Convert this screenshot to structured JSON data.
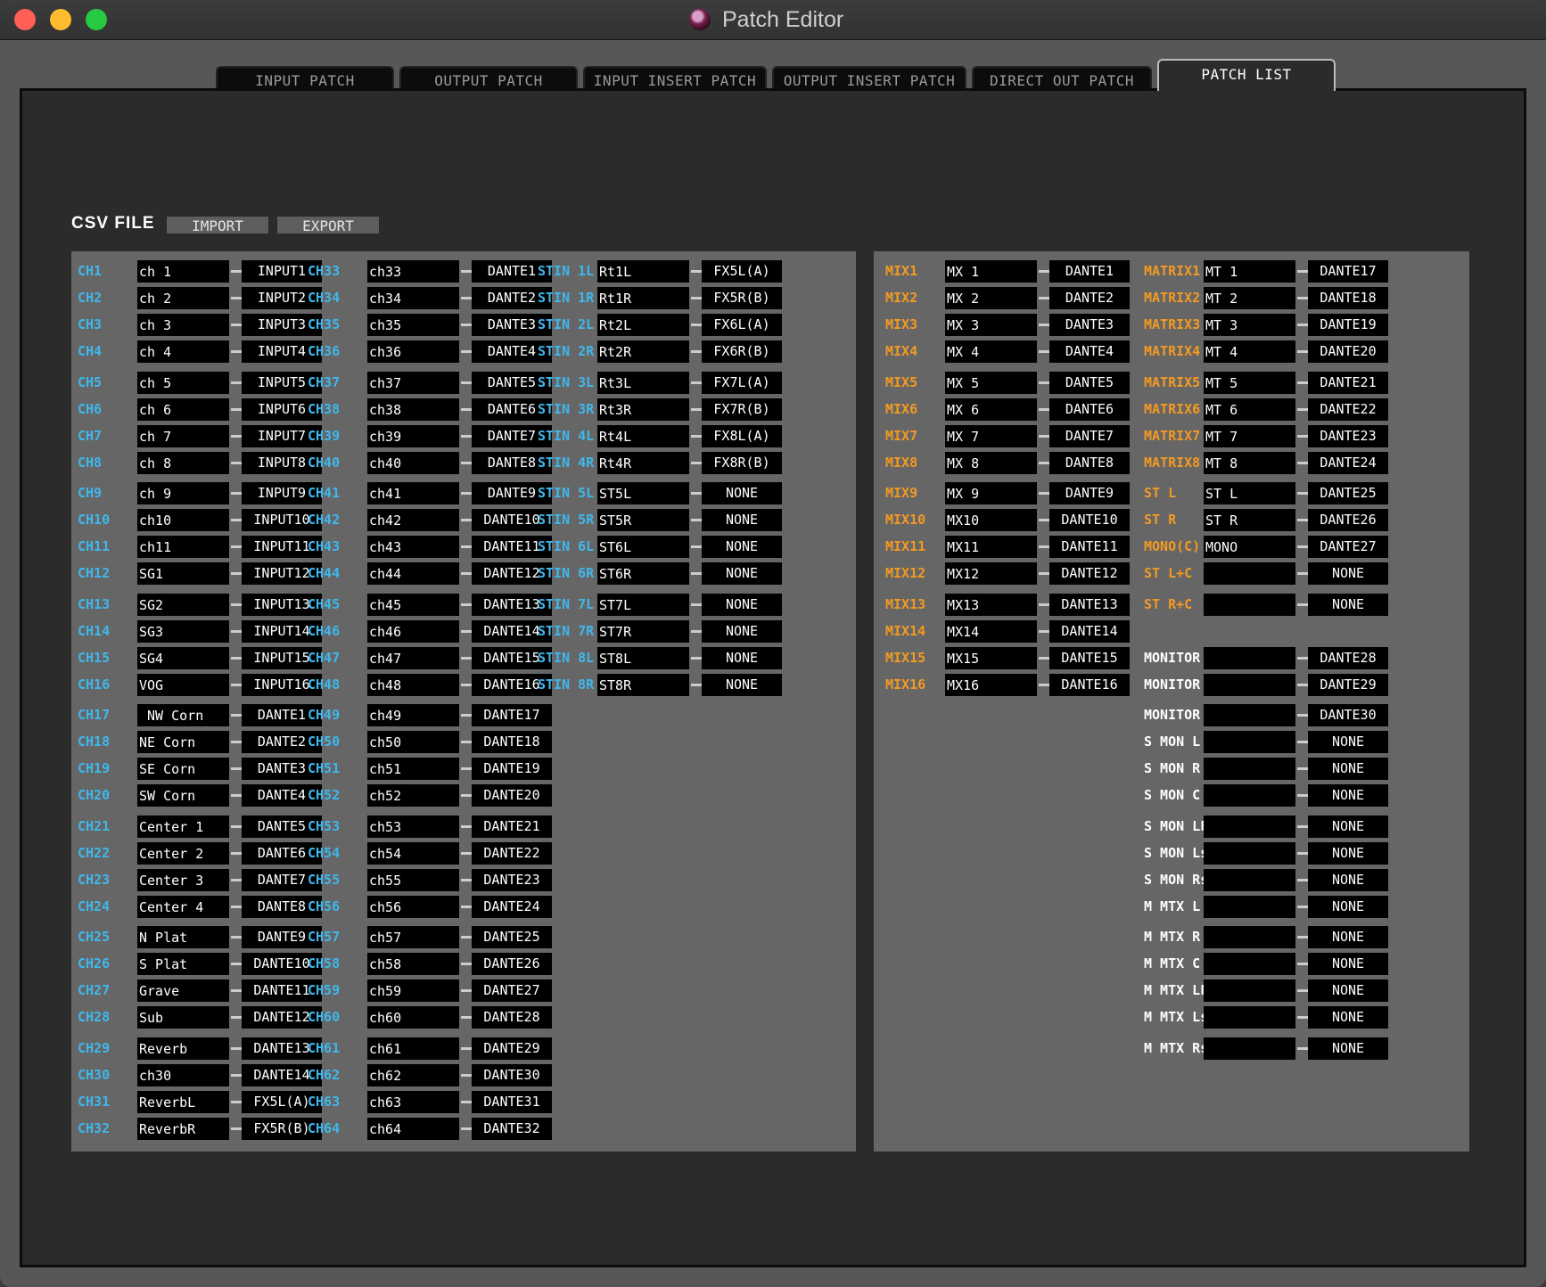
{
  "window": {
    "title": "Patch Editor"
  },
  "tabs": [
    {
      "label": "INPUT PATCH"
    },
    {
      "label": "OUTPUT PATCH"
    },
    {
      "label": "INPUT INSERT PATCH"
    },
    {
      "label": "OUTPUT INSERT PATCH"
    },
    {
      "label": "DIRECT OUT PATCH"
    },
    {
      "label": "PATCH LIST",
      "active": true
    }
  ],
  "csv": {
    "label": "CSV FILE",
    "import": "IMPORT",
    "export": "EXPORT"
  },
  "colors": {
    "input_label": "#3eb8ec",
    "output_label": "#f39a21",
    "monitor_label": "#ffffff",
    "cell_bg": "#000000",
    "panel_bg": "#666666"
  },
  "input_list": {
    "columns": [
      {
        "color": "cyan",
        "rows": [
          {
            "label": "CH1",
            "name": "ch 1",
            "patch": "INPUT1"
          },
          {
            "label": "CH2",
            "name": "ch 2",
            "patch": "INPUT2"
          },
          {
            "label": "CH3",
            "name": "ch 3",
            "patch": "INPUT3"
          },
          {
            "label": "CH4",
            "name": "ch 4",
            "patch": "INPUT4"
          },
          {
            "label": "CH5",
            "name": "ch 5",
            "patch": "INPUT5"
          },
          {
            "label": "CH6",
            "name": "ch 6",
            "patch": "INPUT6"
          },
          {
            "label": "CH7",
            "name": "ch 7",
            "patch": "INPUT7"
          },
          {
            "label": "CH8",
            "name": "ch 8",
            "patch": "INPUT8"
          },
          {
            "label": "CH9",
            "name": "ch 9",
            "patch": "INPUT9"
          },
          {
            "label": "CH10",
            "name": "ch10",
            "patch": "INPUT10"
          },
          {
            "label": "CH11",
            "name": "ch11",
            "patch": "INPUT11"
          },
          {
            "label": "CH12",
            "name": "SG1",
            "patch": "INPUT12"
          },
          {
            "label": "CH13",
            "name": "SG2",
            "patch": "INPUT13"
          },
          {
            "label": "CH14",
            "name": "SG3",
            "patch": "INPUT14"
          },
          {
            "label": "CH15",
            "name": "SG4",
            "patch": "INPUT15"
          },
          {
            "label": "CH16",
            "name": "VOG",
            "patch": "INPUT16"
          },
          {
            "label": "CH17",
            "name": " NW Corn",
            "patch": "DANTE1"
          },
          {
            "label": "CH18",
            "name": "NE Corn",
            "patch": "DANTE2"
          },
          {
            "label": "CH19",
            "name": "SE Corn",
            "patch": "DANTE3"
          },
          {
            "label": "CH20",
            "name": "SW Corn",
            "patch": "DANTE4"
          },
          {
            "label": "CH21",
            "name": "Center 1",
            "patch": "DANTE5"
          },
          {
            "label": "CH22",
            "name": "Center 2",
            "patch": "DANTE6"
          },
          {
            "label": "CH23",
            "name": "Center 3",
            "patch": "DANTE7"
          },
          {
            "label": "CH24",
            "name": "Center 4",
            "patch": "DANTE8"
          },
          {
            "label": "CH25",
            "name": "N Plat",
            "patch": "DANTE9"
          },
          {
            "label": "CH26",
            "name": "S Plat",
            "patch": "DANTE10"
          },
          {
            "label": "CH27",
            "name": "Grave",
            "patch": "DANTE11"
          },
          {
            "label": "CH28",
            "name": "Sub",
            "patch": "DANTE12"
          },
          {
            "label": "CH29",
            "name": "Reverb",
            "patch": "DANTE13"
          },
          {
            "label": "CH30",
            "name": "ch30",
            "patch": "DANTE14"
          },
          {
            "label": "CH31",
            "name": "ReverbL",
            "patch": "FX5L(A)"
          },
          {
            "label": "CH32",
            "name": "ReverbR",
            "patch": "FX5R(B)"
          }
        ]
      },
      {
        "color": "cyan",
        "rows": [
          {
            "label": "CH33",
            "name": "ch33",
            "patch": "DANTE1"
          },
          {
            "label": "CH34",
            "name": "ch34",
            "patch": "DANTE2"
          },
          {
            "label": "CH35",
            "name": "ch35",
            "patch": "DANTE3"
          },
          {
            "label": "CH36",
            "name": "ch36",
            "patch": "DANTE4"
          },
          {
            "label": "CH37",
            "name": "ch37",
            "patch": "DANTE5"
          },
          {
            "label": "CH38",
            "name": "ch38",
            "patch": "DANTE6"
          },
          {
            "label": "CH39",
            "name": "ch39",
            "patch": "DANTE7"
          },
          {
            "label": "CH40",
            "name": "ch40",
            "patch": "DANTE8"
          },
          {
            "label": "CH41",
            "name": "ch41",
            "patch": "DANTE9"
          },
          {
            "label": "CH42",
            "name": "ch42",
            "patch": "DANTE10"
          },
          {
            "label": "CH43",
            "name": "ch43",
            "patch": "DANTE11"
          },
          {
            "label": "CH44",
            "name": "ch44",
            "patch": "DANTE12"
          },
          {
            "label": "CH45",
            "name": "ch45",
            "patch": "DANTE13"
          },
          {
            "label": "CH46",
            "name": "ch46",
            "patch": "DANTE14"
          },
          {
            "label": "CH47",
            "name": "ch47",
            "patch": "DANTE15"
          },
          {
            "label": "CH48",
            "name": "ch48",
            "patch": "DANTE16"
          },
          {
            "label": "CH49",
            "name": "ch49",
            "patch": "DANTE17"
          },
          {
            "label": "CH50",
            "name": "ch50",
            "patch": "DANTE18"
          },
          {
            "label": "CH51",
            "name": "ch51",
            "patch": "DANTE19"
          },
          {
            "label": "CH52",
            "name": "ch52",
            "patch": "DANTE20"
          },
          {
            "label": "CH53",
            "name": "ch53",
            "patch": "DANTE21"
          },
          {
            "label": "CH54",
            "name": "ch54",
            "patch": "DANTE22"
          },
          {
            "label": "CH55",
            "name": "ch55",
            "patch": "DANTE23"
          },
          {
            "label": "CH56",
            "name": "ch56",
            "patch": "DANTE24"
          },
          {
            "label": "CH57",
            "name": "ch57",
            "patch": "DANTE25"
          },
          {
            "label": "CH58",
            "name": "ch58",
            "patch": "DANTE26"
          },
          {
            "label": "CH59",
            "name": "ch59",
            "patch": "DANTE27"
          },
          {
            "label": "CH60",
            "name": "ch60",
            "patch": "DANTE28"
          },
          {
            "label": "CH61",
            "name": "ch61",
            "patch": "DANTE29"
          },
          {
            "label": "CH62",
            "name": "ch62",
            "patch": "DANTE30"
          },
          {
            "label": "CH63",
            "name": "ch63",
            "patch": "DANTE31"
          },
          {
            "label": "CH64",
            "name": "ch64",
            "patch": "DANTE32"
          }
        ]
      },
      {
        "color": "cyan",
        "rows": [
          {
            "label": "STIN 1L",
            "name": "Rt1L",
            "patch": "FX5L(A)"
          },
          {
            "label": "STIN 1R",
            "name": "Rt1R",
            "patch": "FX5R(B)"
          },
          {
            "label": "STIN 2L",
            "name": "Rt2L",
            "patch": "FX6L(A)"
          },
          {
            "label": "STIN 2R",
            "name": "Rt2R",
            "patch": "FX6R(B)"
          },
          {
            "label": "STIN 3L",
            "name": "Rt3L",
            "patch": "FX7L(A)"
          },
          {
            "label": "STIN 3R",
            "name": "Rt3R",
            "patch": "FX7R(B)"
          },
          {
            "label": "STIN 4L",
            "name": "Rt4L",
            "patch": "FX8L(A)"
          },
          {
            "label": "STIN 4R",
            "name": "Rt4R",
            "patch": "FX8R(B)"
          },
          {
            "label": "STIN 5L",
            "name": "ST5L",
            "patch": "NONE"
          },
          {
            "label": "STIN 5R",
            "name": "ST5R",
            "patch": "NONE"
          },
          {
            "label": "STIN 6L",
            "name": "ST6L",
            "patch": "NONE"
          },
          {
            "label": "STIN 6R",
            "name": "ST6R",
            "patch": "NONE"
          },
          {
            "label": "STIN 7L",
            "name": "ST7L",
            "patch": "NONE"
          },
          {
            "label": "STIN 7R",
            "name": "ST7R",
            "patch": "NONE"
          },
          {
            "label": "STIN 8L",
            "name": "ST8L",
            "patch": "NONE"
          },
          {
            "label": "STIN 8R",
            "name": "ST8R",
            "patch": "NONE"
          }
        ]
      }
    ]
  },
  "output_list": {
    "columns": [
      {
        "color": "orange",
        "rows": [
          {
            "label": "MIX1",
            "name": "MX 1",
            "patch": "DANTE1"
          },
          {
            "label": "MIX2",
            "name": "MX 2",
            "patch": "DANTE2"
          },
          {
            "label": "MIX3",
            "name": "MX 3",
            "patch": "DANTE3"
          },
          {
            "label": "MIX4",
            "name": "MX 4",
            "patch": "DANTE4"
          },
          {
            "label": "MIX5",
            "name": "MX 5",
            "patch": "DANTE5"
          },
          {
            "label": "MIX6",
            "name": "MX 6",
            "patch": "DANTE6"
          },
          {
            "label": "MIX7",
            "name": "MX 7",
            "patch": "DANTE7"
          },
          {
            "label": "MIX8",
            "name": "MX 8",
            "patch": "DANTE8"
          },
          {
            "label": "MIX9",
            "name": "MX 9",
            "patch": "DANTE9"
          },
          {
            "label": "MIX10",
            "name": "MX10",
            "patch": "DANTE10"
          },
          {
            "label": "MIX11",
            "name": "MX11",
            "patch": "DANTE11"
          },
          {
            "label": "MIX12",
            "name": "MX12",
            "patch": "DANTE12"
          },
          {
            "label": "MIX13",
            "name": "MX13",
            "patch": "DANTE13"
          },
          {
            "label": "MIX14",
            "name": "MX14",
            "patch": "DANTE14"
          },
          {
            "label": "MIX15",
            "name": "MX15",
            "patch": "DANTE15"
          },
          {
            "label": "MIX16",
            "name": "MX16",
            "patch": "DANTE16"
          }
        ]
      },
      {
        "color": "orange",
        "rows": [
          {
            "label": "MATRIX1",
            "name": "MT 1",
            "patch": "DANTE17"
          },
          {
            "label": "MATRIX2",
            "name": "MT 2",
            "patch": "DANTE18"
          },
          {
            "label": "MATRIX3",
            "name": "MT 3",
            "patch": "DANTE19"
          },
          {
            "label": "MATRIX4",
            "name": "MT 4",
            "patch": "DANTE20"
          },
          {
            "label": "MATRIX5",
            "name": "MT 5",
            "patch": "DANTE21"
          },
          {
            "label": "MATRIX6",
            "name": "MT 6",
            "patch": "DANTE22"
          },
          {
            "label": "MATRIX7",
            "name": "MT 7",
            "patch": "DANTE23"
          },
          {
            "label": "MATRIX8",
            "name": "MT 8",
            "patch": "DANTE24"
          },
          {
            "label": "ST L",
            "name": "ST L",
            "patch": "DANTE25"
          },
          {
            "label": "ST R",
            "name": "ST R",
            "patch": "DANTE26"
          },
          {
            "label": "MONO(C)",
            "name": "MONO",
            "patch": "DANTE27"
          },
          {
            "label": "ST L+C",
            "name": "",
            "patch": "NONE"
          },
          {
            "label": "ST R+C",
            "name": "",
            "patch": "NONE"
          }
        ]
      },
      {
        "color": "white",
        "rows": [
          {
            "label": "MONITOR L",
            "name": "",
            "patch": "DANTE28"
          },
          {
            "label": "MONITOR R",
            "name": "",
            "patch": "DANTE29"
          },
          {
            "label": "MONITOR C",
            "name": "",
            "patch": "DANTE30"
          },
          {
            "label": "S MON L",
            "name": "",
            "patch": "NONE"
          },
          {
            "label": "S MON R",
            "name": "",
            "patch": "NONE"
          },
          {
            "label": "S MON C",
            "name": "",
            "patch": "NONE"
          },
          {
            "label": "S MON LFE",
            "name": "",
            "patch": "NONE"
          },
          {
            "label": "S MON Ls",
            "name": "",
            "patch": "NONE"
          },
          {
            "label": "S MON Rs",
            "name": "",
            "patch": "NONE"
          },
          {
            "label": "M MTX L",
            "name": "",
            "patch": "NONE"
          },
          {
            "label": "M MTX R",
            "name": "",
            "patch": "NONE"
          },
          {
            "label": "M MTX C",
            "name": "",
            "patch": "NONE"
          },
          {
            "label": "M MTX LFE",
            "name": "",
            "patch": "NONE"
          },
          {
            "label": "M MTX Ls",
            "name": "",
            "patch": "NONE"
          },
          {
            "label": "M MTX Rs",
            "name": "",
            "patch": "NONE"
          }
        ]
      }
    ]
  }
}
